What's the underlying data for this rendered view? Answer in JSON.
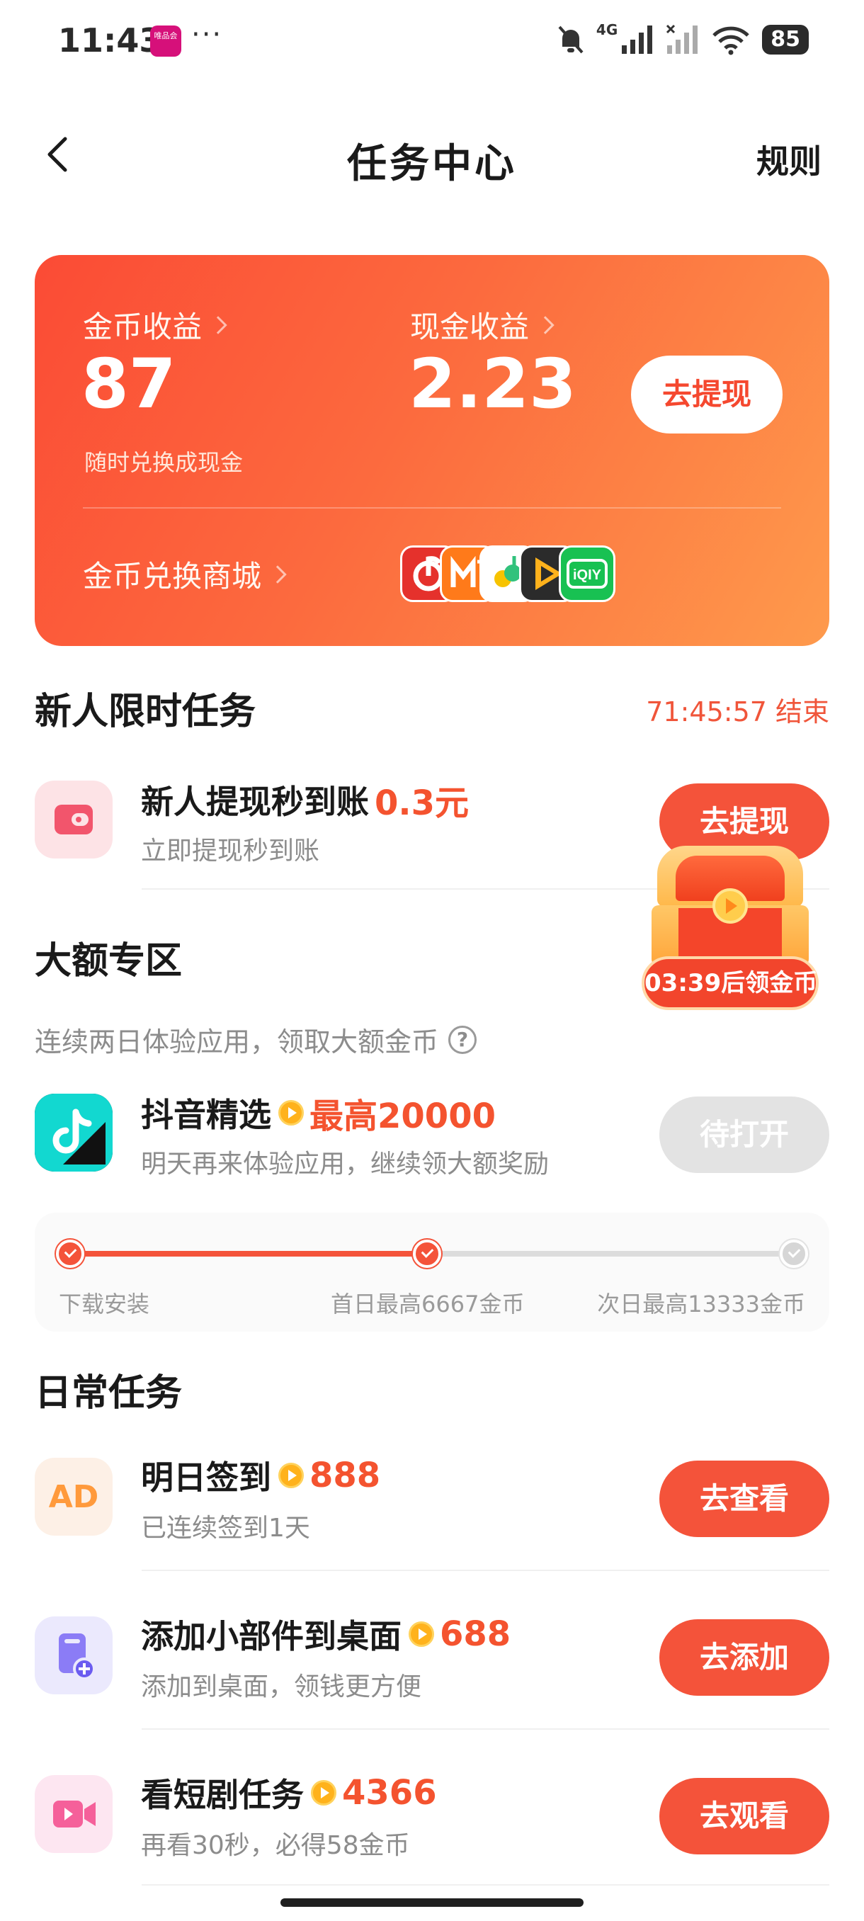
{
  "status_bar": {
    "time": "11:43",
    "app_badge": "唯品会",
    "dots": "···",
    "network": "4G",
    "battery": "85"
  },
  "header": {
    "title": "任务中心",
    "rules": "规则"
  },
  "earnings": {
    "coin_label": "金币收益",
    "coin_value": "87",
    "coin_sub": "随时兑换成现金",
    "cash_label": "现金收益",
    "cash_value": "2.23",
    "withdraw_button": "去提现",
    "mall_label": "金币兑换商城",
    "mall_apps": [
      "netease-music-icon",
      "mango-tv-icon",
      "qq-music-icon",
      "tencent-video-icon",
      "iqiyi-icon"
    ]
  },
  "newbie": {
    "title": "新人限时任务",
    "countdown": "71:45:57 结束",
    "task": {
      "name": "新人提现秒到账",
      "reward": "0.3元",
      "desc": "立即提现秒到账",
      "button": "去提现"
    }
  },
  "chest": {
    "timer": "03:39后领金币"
  },
  "big_zone": {
    "title": "大额专区",
    "desc": "连续两日体验应用，领取大额金币",
    "task": {
      "name": "抖音精选",
      "reward": "最高20000",
      "desc": "明天再来体验应用，继续领大额奖励",
      "button": "待打开"
    },
    "steps": [
      "下载安装",
      "首日最高6667金币",
      "次日最高13333金币"
    ],
    "steps_completed": 2
  },
  "daily": {
    "title": "日常任务",
    "tasks": [
      {
        "name": "明日签到",
        "reward": "888",
        "desc": "已连续签到1天",
        "button": "去查看",
        "icon": "AD"
      },
      {
        "name": "添加小部件到桌面",
        "reward": "688",
        "desc": "添加到桌面，领钱更方便",
        "button": "去添加"
      },
      {
        "name": "看短剧任务",
        "reward": "4366",
        "desc": "再看30秒，必得58金币",
        "button": "去观看"
      }
    ]
  },
  "colors": {
    "accent": "#f4533a",
    "card_gradient_start": "#fb4b35",
    "card_gradient_end": "#fe9a4c",
    "disabled": "#e3e3e3"
  }
}
